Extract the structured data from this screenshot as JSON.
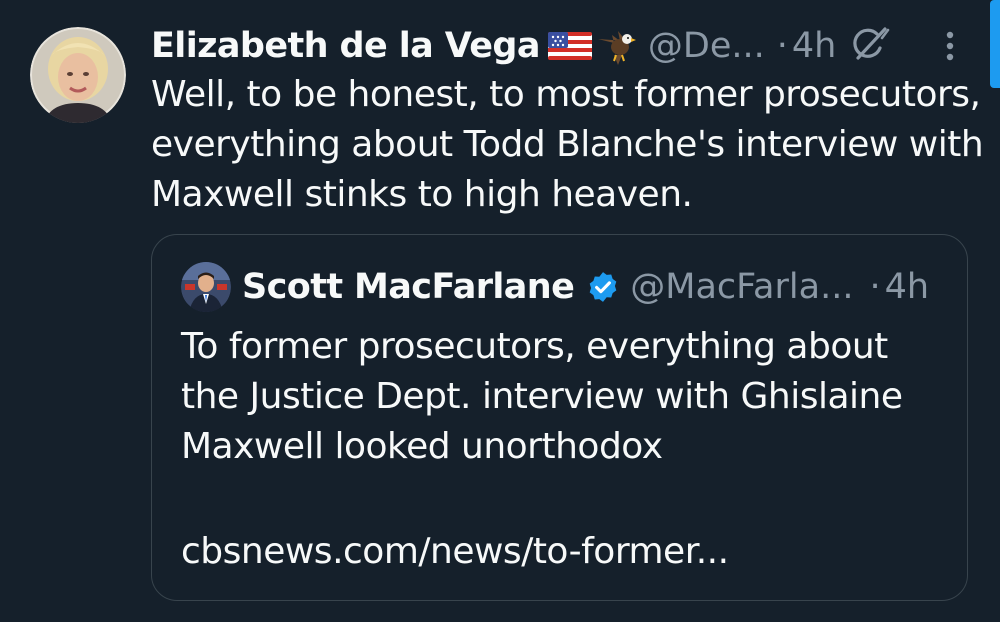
{
  "tweet": {
    "author": {
      "display_name": "Elizabeth de la Vega",
      "emojis": [
        "us-flag-icon",
        "eagle-icon"
      ],
      "handle": "@De...",
      "avatar": "avatar-photo"
    },
    "separator": "·",
    "time": "4h",
    "actions": {
      "grok_icon": "grok-icon",
      "more_icon": "more-options-icon"
    },
    "text": "Well, to be honest, to most former prosecutors, everything about Todd Blanche's interview with Maxwell stinks to high heaven."
  },
  "quoted_tweet": {
    "author": {
      "display_name": "Scott MacFarlane",
      "verified": true,
      "handle": "@MacFarla...",
      "avatar": "avatar-photo"
    },
    "separator": "·",
    "time": "4h",
    "text": "To former prosecutors, everything about the Justice Dept. interview with Ghislaine Maxwell looked unorthodox",
    "link": "cbsnews.com/news/to-former..."
  },
  "colors": {
    "background": "#15202b",
    "text_primary": "#f7f9f9",
    "text_secondary": "#8b98a5",
    "border": "#38444d",
    "accent": "#1d9bf0"
  }
}
